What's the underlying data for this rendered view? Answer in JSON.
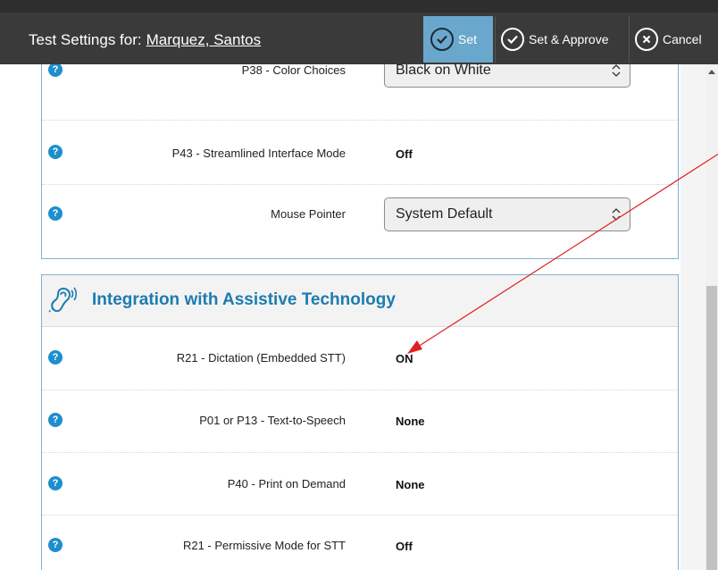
{
  "header": {
    "title_prefix": "Test Settings for:",
    "student_name": "Marquez, Santos",
    "buttons": {
      "set": "Set",
      "set_approve": "Set & Approve",
      "cancel": "Cancel"
    }
  },
  "help_glyph": "?",
  "panel1": {
    "rows": [
      {
        "label": "P38 - Color Choices",
        "select_value": "Black on White"
      },
      {
        "label": "P43 - Streamlined Interface Mode",
        "value": "Off"
      },
      {
        "label": "Mouse Pointer",
        "select_value": "System Default"
      }
    ]
  },
  "panel2": {
    "title": "Integration with Assistive Technology",
    "icon": "hearing-ear-icon",
    "rows": [
      {
        "label": "R21 - Dictation (Embedded STT)",
        "value": "ON"
      },
      {
        "label": "P01 or P13 - Text-to-Speech",
        "value": "None"
      },
      {
        "label": "P40 - Print on Demand",
        "value": "None"
      },
      {
        "label": "R21 - Permissive Mode for STT",
        "value": "Off"
      }
    ]
  },
  "colors": {
    "header_bg": "#3a3a3a",
    "set_button_bg": "#6aa7cc",
    "section_title": "#1d7bb0",
    "help_icon": "#1e8fcc",
    "annotation_arrow": "#e02020"
  }
}
